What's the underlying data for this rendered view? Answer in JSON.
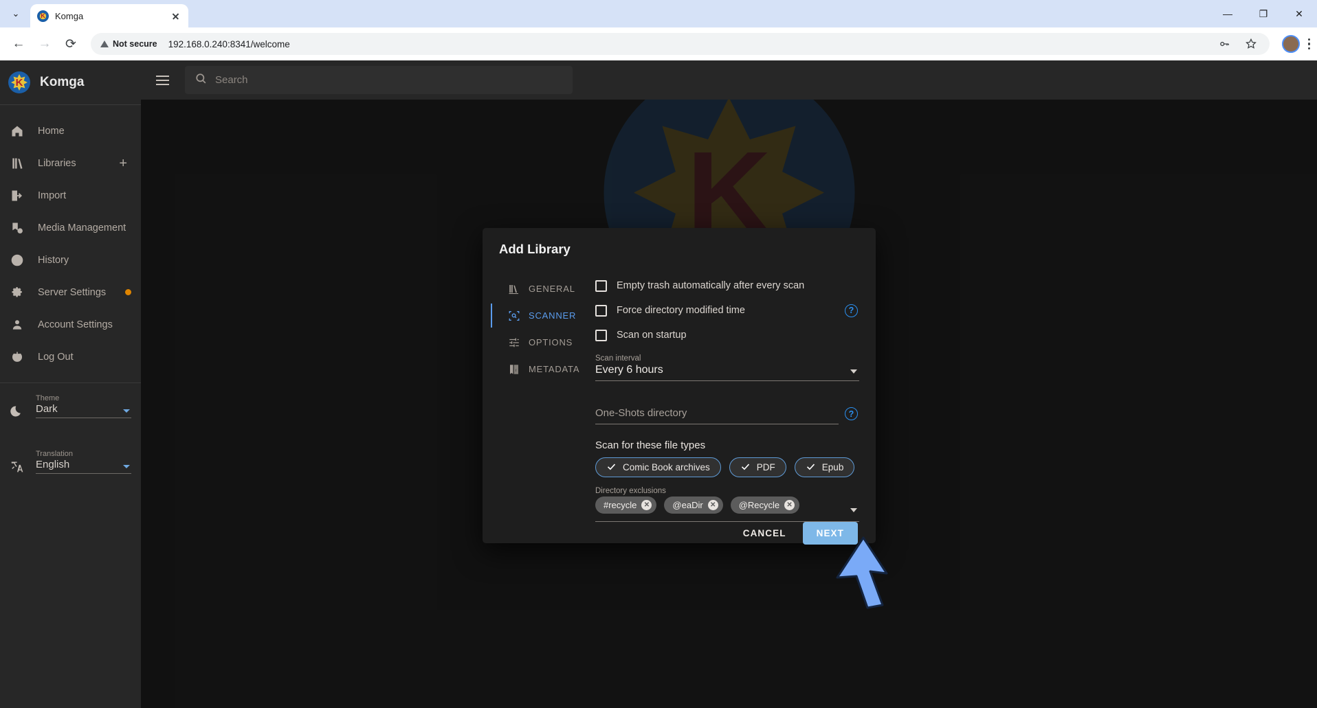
{
  "browser": {
    "tab": {
      "title": "Komga",
      "favicon": "komga-favicon",
      "close": "×"
    },
    "chevron": "⌄",
    "window_controls": {
      "minimize": "—",
      "maximize": "❐",
      "close": "✕"
    },
    "nav": {
      "back": "←",
      "forward": "→",
      "reload": "⟳"
    },
    "omnibox": {
      "security_label": "Not secure",
      "url": "192.168.0.240:8341/welcome"
    },
    "toolbar_icons": [
      "password-key-icon",
      "bookmark-star-icon",
      "profile-avatar",
      "chrome-menu-kebab"
    ]
  },
  "sidebar": {
    "brand": "Komga",
    "items": [
      {
        "label": "Home",
        "icon": "home-icon"
      },
      {
        "label": "Libraries",
        "icon": "library-books-icon",
        "action": "+"
      },
      {
        "label": "Import",
        "icon": "import-arrow-icon"
      },
      {
        "label": "Media Management",
        "icon": "media-gear-icon"
      },
      {
        "label": "History",
        "icon": "clock-icon"
      },
      {
        "label": "Server Settings",
        "icon": "gear-icon",
        "badge_color": "#e08500"
      },
      {
        "label": "Account Settings",
        "icon": "person-icon"
      },
      {
        "label": "Log Out",
        "icon": "power-icon"
      }
    ],
    "theme": {
      "label": "Theme",
      "value": "Dark",
      "icon": "moon-icon"
    },
    "translation": {
      "label": "Translation",
      "value": "English",
      "icon": "translate-icon"
    }
  },
  "appbar": {
    "menu": "hamburger-icon",
    "search": {
      "placeholder": "Search",
      "icon": "search-icon"
    }
  },
  "dialog": {
    "title": "Add Library",
    "tabs": [
      {
        "label": "GENERAL",
        "icon": "library-icon",
        "active": false
      },
      {
        "label": "SCANNER",
        "icon": "scan-icon",
        "active": true
      },
      {
        "label": "OPTIONS",
        "icon": "sliders-icon",
        "active": false
      },
      {
        "label": "METADATA",
        "icon": "metadata-icon",
        "active": false
      }
    ],
    "checkboxes": [
      {
        "label": "Empty trash automatically after every scan",
        "checked": false,
        "help": false
      },
      {
        "label": "Force directory modified time",
        "checked": false,
        "help": true
      },
      {
        "label": "Scan on startup",
        "checked": false,
        "help": false
      }
    ],
    "scan_interval": {
      "label": "Scan interval",
      "value": "Every 6 hours"
    },
    "one_shots": {
      "placeholder": "One-Shots directory",
      "value": "",
      "help": true
    },
    "file_types": {
      "title": "Scan for these file types",
      "chips": [
        {
          "label": "Comic Book archives",
          "selected": true
        },
        {
          "label": "PDF",
          "selected": true
        },
        {
          "label": "Epub",
          "selected": true
        }
      ]
    },
    "exclusions": {
      "label": "Directory exclusions",
      "chips": [
        "#recycle",
        "@eaDir",
        "@Recycle"
      ],
      "remove_glyph": "✕"
    },
    "actions": {
      "cancel": "CANCEL",
      "next": "NEXT"
    },
    "accent_color": "#5a9ced",
    "primary_button_color": "#7eb8e8"
  },
  "cursor": {
    "type": "arrow-pointer",
    "color": "#7aaaf7"
  }
}
